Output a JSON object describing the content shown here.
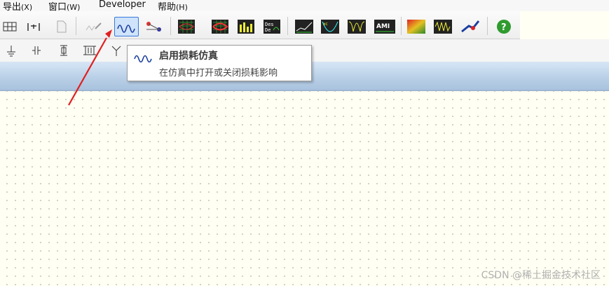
{
  "menubar": {
    "items": [
      {
        "label": "导出",
        "accel": "(X)"
      },
      {
        "label": "窗口",
        "accel": "(W)"
      },
      {
        "label": "Developer",
        "accel": ""
      },
      {
        "label": "帮助",
        "accel": "(H)"
      }
    ]
  },
  "toolbar1": {
    "icons": [
      "table-icon",
      "schematic-icon",
      "document-icon",
      "magic-wand-icon",
      "lossy-wave-icon",
      "network-icon",
      "eye-diagram-grid-icon",
      "eye-diagram-red-icon",
      "bar-chart-icon",
      "des-icon",
      "waveform-icon",
      "bathtub-icon",
      "frequency-icon",
      "ami-icon",
      "heatmap-icon",
      "jitter-icon",
      "sweep-icon",
      "help-icon"
    ],
    "active_icon": "lossy-wave-icon"
  },
  "toolbar2": {
    "icons": [
      "ground-icon",
      "capacitor-icon",
      "resistor-icon",
      "transformer-icon",
      "split-icon"
    ]
  },
  "tooltip": {
    "title": "启用损耗仿真",
    "description": "在仿真中打开或关闭损耗影响"
  },
  "annotation": {
    "arrow_color": "#e02020"
  },
  "watermark": "CSDN @稀土掘金技术社区"
}
